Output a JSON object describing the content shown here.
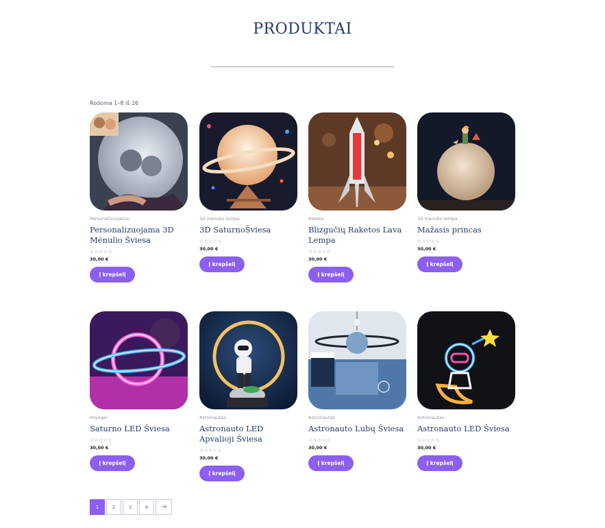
{
  "page": {
    "title": "PRODUKTAI",
    "result_count": "Rodoma 1–8 iš 26"
  },
  "products": [
    {
      "category": "Personalizuojama",
      "name": "Personalizuojama 3D Mėnulio Šviesa",
      "stars": "☆☆☆☆☆",
      "price": "30,00 €",
      "cart_label": "Į krepšelį",
      "image": "moon-photo-lamp"
    },
    {
      "category": "3d menulio lempa",
      "name": "3D SaturnoŠviesa",
      "stars": "☆☆☆☆☆",
      "price": "30,00 €",
      "cart_label": "Į krepšelį",
      "image": "saturn-lamp"
    },
    {
      "category": "Raketa",
      "name": "Blizgučių Raketos Lava Lempa",
      "stars": "☆☆☆☆☆",
      "price": "30,00 €",
      "cart_label": "Į krepšelį",
      "image": "rocket-lava-lamp"
    },
    {
      "category": "3d menulio lempa",
      "name": "Mažasis princas",
      "stars": "☆☆☆☆☆",
      "price": "30,00 €",
      "cart_label": "Į krepšelį",
      "image": "little-prince-lamp"
    },
    {
      "category": "Voyager",
      "name": "Saturno LED Šviesa",
      "stars": "☆☆☆☆☆",
      "price": "30,00 €",
      "cart_label": "Į krepšelį",
      "image": "saturn-neon-light"
    },
    {
      "category": "Astronautas",
      "name": "Astronauto LED Apvalioji Šviesa",
      "stars": "☆☆☆☆☆",
      "price": "30,00 €",
      "cart_label": "Į krepšelį",
      "image": "astronaut-ring-lamp"
    },
    {
      "category": "Astronautas",
      "name": "Astronauto Lubų Šviesa",
      "stars": "☆☆☆☆☆",
      "price": "30,00 €",
      "cart_label": "Į krepšelį",
      "image": "astronaut-ceiling-light"
    },
    {
      "category": "Astronautas",
      "name": "Astronauto LED Šviesa",
      "stars": "☆☆☆☆☆",
      "price": "30,00 €",
      "cart_label": "Į krepšelį",
      "image": "astronaut-neon-light"
    }
  ],
  "pagination": {
    "pages": [
      "1",
      "2",
      "3",
      "4"
    ],
    "current": "1",
    "next_label": "→"
  },
  "colors": {
    "accent": "#8c5ff0",
    "title": "#233a66"
  }
}
